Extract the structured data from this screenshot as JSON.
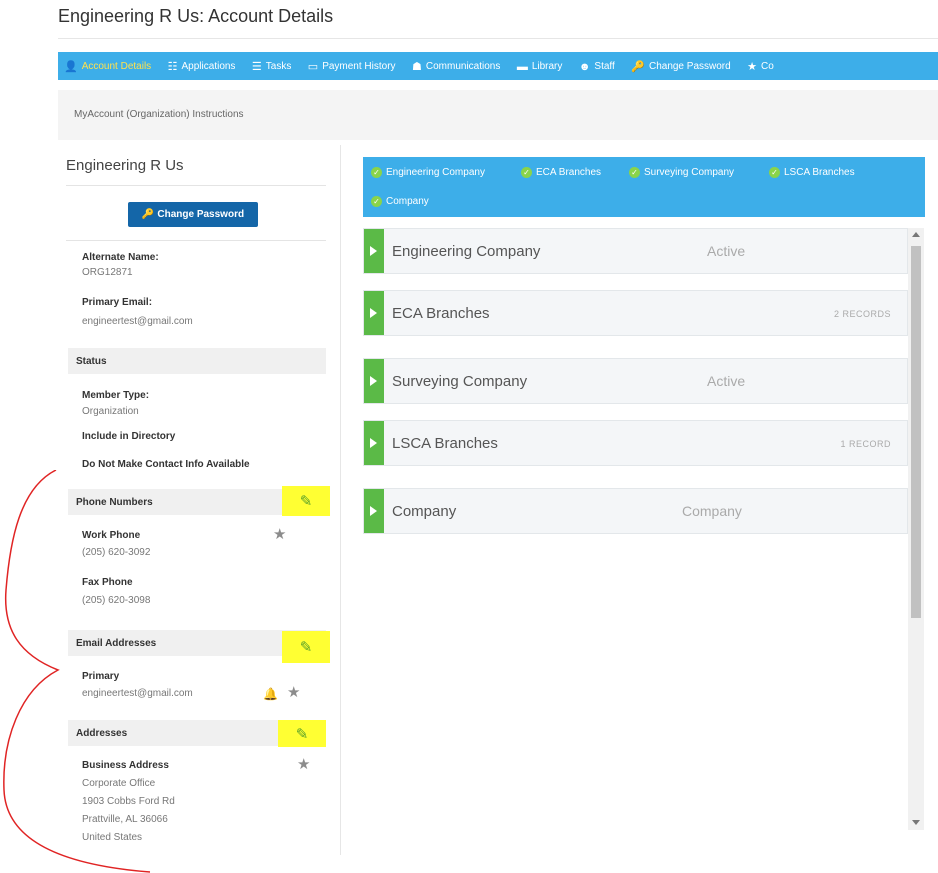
{
  "page": {
    "title": "Engineering R Us: Account Details"
  },
  "nav": {
    "items": [
      {
        "label": "Account Details",
        "icon": "user-icon",
        "glyph": "👤"
      },
      {
        "label": "Applications",
        "icon": "list-icon",
        "glyph": "☷"
      },
      {
        "label": "Tasks",
        "icon": "list-icon",
        "glyph": "☰"
      },
      {
        "label": "Payment History",
        "icon": "money-icon",
        "glyph": "▭"
      },
      {
        "label": "Communications",
        "icon": "bullhorn-icon",
        "glyph": "☗"
      },
      {
        "label": "Library",
        "icon": "folder-icon",
        "glyph": "▬"
      },
      {
        "label": "Staff",
        "icon": "users-icon",
        "glyph": "☻"
      },
      {
        "label": "Change Password",
        "icon": "key-icon",
        "glyph": "🔑"
      },
      {
        "label": "Co",
        "icon": "star-icon",
        "glyph": "★"
      }
    ],
    "active_color": "#ffe14d",
    "bar_color": "#3daee9"
  },
  "instructions": {
    "label": "MyAccount (Organization) Instructions"
  },
  "profile": {
    "name": "Engineering R Us",
    "change_password_label": "Change Password",
    "alternate_name_label": "Alternate Name:",
    "alternate_name_value": "ORG12871",
    "primary_email_label": "Primary Email:",
    "primary_email_value": "engineertest@gmail.com",
    "status_header": "Status",
    "member_type_label": "Member Type:",
    "member_type_value": "Organization",
    "include_directory_label": "Include in Directory",
    "no_contact_label": "Do Not Make Contact Info Available"
  },
  "phones": {
    "header": "Phone Numbers",
    "work_label": "Work Phone",
    "work_value": "(205) 620-3092",
    "fax_label": "Fax Phone",
    "fax_value": "(205) 620-3098"
  },
  "emails": {
    "header": "Email Addresses",
    "primary_label": "Primary",
    "primary_value": "engineertest@gmail.com"
  },
  "addresses": {
    "header": "Addresses",
    "business_label": "Business Address",
    "lines": [
      "Corporate Office",
      "1903 Cobbs Ford Rd",
      "Prattville, AL 36066",
      "United States"
    ]
  },
  "tags": [
    "Engineering Company",
    "ECA Branches",
    "Surveying Company",
    "LSCA Branches",
    "Company"
  ],
  "panels": [
    {
      "title": "Engineering Company",
      "status": "Active",
      "records": ""
    },
    {
      "title": "ECA Branches",
      "status": "",
      "records": "2 RECORDS"
    },
    {
      "title": "Surveying Company",
      "status": "Active",
      "records": ""
    },
    {
      "title": "LSCA Branches",
      "status": "",
      "records": "1 RECORD"
    },
    {
      "title": "Company",
      "status": "Company",
      "records": ""
    }
  ],
  "colors": {
    "highlight": "#ffff33",
    "accent_green": "#5bba47",
    "button_blue": "#1466a8",
    "annotation_red": "#e02424"
  }
}
